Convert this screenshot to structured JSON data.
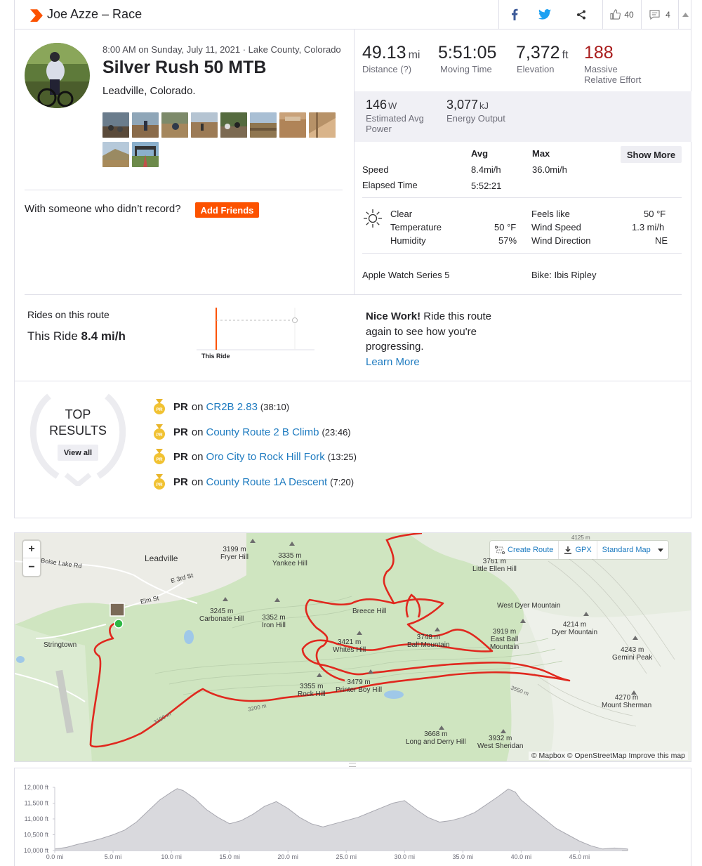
{
  "header": {
    "athlete_activity": "Joe Azze – Race",
    "kudos_count": "40",
    "comments_count": "4"
  },
  "activity": {
    "datetime": "8:00 AM on Sunday, July 11, 2021 · Lake County, Colorado",
    "title": "Silver Rush 50 MTB",
    "description": "Leadville, Colorado.",
    "friends_prompt": "With someone who didn’t record?",
    "add_friends_label": "Add Friends"
  },
  "stats": {
    "distance": {
      "value": "49.13",
      "unit": "mi",
      "label": "Distance (?)"
    },
    "moving_time": {
      "value": "5:51:05",
      "label": "Moving Time"
    },
    "elevation": {
      "value": "7,372",
      "unit": "ft",
      "label": "Elevation"
    },
    "relative_effort": {
      "value": "188",
      "label_1": "Massive",
      "label_2": "Relative Effort"
    },
    "power": {
      "value": "146",
      "unit": "W",
      "label_1": "Estimated Avg",
      "label_2": "Power"
    },
    "energy": {
      "value": "3,077",
      "unit": "kJ",
      "label": "Energy Output"
    }
  },
  "more_stats": {
    "col_avg": "Avg",
    "col_max": "Max",
    "show_more_label": "Show More",
    "rows": [
      {
        "label": "Speed",
        "avg": "8.4mi/h",
        "max": "36.0mi/h"
      },
      {
        "label": "Elapsed Time",
        "avg": "5:52:21",
        "max": ""
      }
    ]
  },
  "weather": {
    "icon": "sun-icon",
    "left": [
      {
        "label": "Clear",
        "value": ""
      },
      {
        "label": "Temperature",
        "value": "50 °F"
      },
      {
        "label": "Humidity",
        "value": "57%"
      }
    ],
    "right": [
      {
        "label": "Feels like",
        "value": "50 °F"
      },
      {
        "label": "Wind Speed",
        "value": "1.3 mi/h"
      },
      {
        "label": "Wind Direction",
        "value": "NE"
      }
    ]
  },
  "gear": {
    "device": "Apple Watch Series 5",
    "bike": "Bike: Ibis Ripley"
  },
  "route": {
    "rides_label": "Rides on this route",
    "this_ride_prefix": "This Ride",
    "this_ride_value": "8.4 mi/h",
    "marker_label": "This Ride",
    "nice_bold": "Nice Work!",
    "nice_text": "Ride this route again to see how you're progressing.",
    "learn_more": "Learn More"
  },
  "top_results": {
    "title_1": "TOP",
    "title_2": "RESULTS",
    "view_all": "View all",
    "items": [
      {
        "badge": "PR",
        "on": "on",
        "segment": "CR2B 2.83",
        "time": "(38:10)"
      },
      {
        "badge": "PR",
        "on": "on",
        "segment": "County Route 2 B Climb",
        "time": "(23:46)"
      },
      {
        "badge": "PR",
        "on": "on",
        "segment": "Oro City to Rock Hill Fork",
        "time": "(13:25)"
      },
      {
        "badge": "PR",
        "on": "on",
        "segment": "County Route 1A Descent",
        "time": "(7:20)"
      }
    ]
  },
  "map": {
    "zoom_in": "+",
    "zoom_out": "−",
    "create_route": "Create Route",
    "gpx": "GPX",
    "map_type": "Standard Map",
    "attribution": "© Mapbox © OpenStreetMap Improve this map",
    "places": {
      "leadville": "Leadville",
      "stringtown": "Stringtown",
      "boise_lake_rd": "Boise Lake Rd",
      "e3rd": "E 3rd St",
      "elm": "Elm St",
      "fryer": "3199 m\nFryer Hill",
      "yankee": "3335 m\nYankee Hill",
      "carbonate": "3245 m\nCarbonate Hill",
      "iron": "3352 m\nIron Hill",
      "breece": "Breece Hill",
      "whites": "3421 m\nWhites Hill",
      "ball": "3748 m\nBall Mountain",
      "rock": "3355 m\nRock Hill",
      "printer": "3479 m\nPrinter Boy Hill",
      "little_ellen": "3761 m\nLittle Ellen Hill",
      "west_dyer": "West Dyer Mountain",
      "east_ball": "3919 m\nEast Ball\nMountain",
      "dyer": "4214 m\nDyer Mountain",
      "gemini": "4243 m\nGemini Peak",
      "sherman": "4270 m\nMount Sherman",
      "long_derry": "3668 m\nLong and Derry Hill",
      "west_sheridan": "3932 m\nWest Sheridan",
      "c3100": "3100 m",
      "c3200": "3200 m",
      "c3550": "3550 m",
      "c4125": "4125 m"
    }
  },
  "chart_data": {
    "type": "area",
    "title": "",
    "xlabel": "",
    "ylabel": "",
    "x_unit": "mi",
    "y_unit": "ft",
    "xlim": [
      0,
      49.13
    ],
    "ylim": [
      10000,
      12000
    ],
    "x_ticks": [
      "0.0 mi",
      "5.0 mi",
      "10.0 mi",
      "15.0 mi",
      "20.0 mi",
      "25.0 mi",
      "30.0 mi",
      "35.0 mi",
      "40.0 mi",
      "45.0 mi"
    ],
    "y_ticks": [
      "12,000 ft",
      "11,500 ft",
      "11,000 ft",
      "10,500 ft",
      "10,000 ft"
    ],
    "x": [
      0,
      1,
      2,
      3,
      4,
      5,
      6,
      7,
      8,
      9,
      10,
      10.5,
      11,
      12,
      13,
      14,
      15,
      16,
      17,
      18,
      19,
      20,
      21,
      22,
      23,
      24,
      25,
      26,
      27,
      28,
      29,
      30,
      31,
      32,
      33,
      34,
      35,
      36,
      37,
      38,
      38.9,
      39.5,
      40,
      41,
      42,
      43,
      44,
      45,
      46,
      47,
      48,
      49.13
    ],
    "y": [
      10050,
      10100,
      10200,
      10280,
      10380,
      10500,
      10650,
      10900,
      11250,
      11600,
      11850,
      11960,
      11900,
      11650,
      11300,
      11050,
      10850,
      10950,
      11150,
      11400,
      11550,
      11330,
      11050,
      10850,
      10750,
      10850,
      10950,
      11050,
      11200,
      11350,
      11500,
      11580,
      11300,
      11050,
      10900,
      10950,
      11050,
      11200,
      11450,
      11700,
      11950,
      11850,
      11600,
      11300,
      11000,
      10700,
      10500,
      10300,
      10150,
      10050,
      10080,
      10050
    ],
    "fill_color": "#d9d9dd",
    "line_color": "#a8a8b0"
  }
}
